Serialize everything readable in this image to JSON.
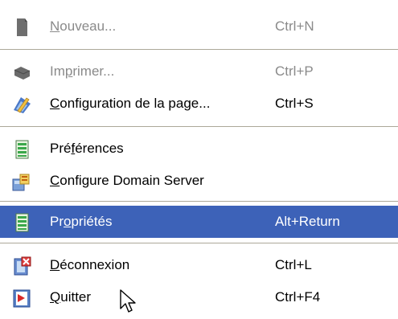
{
  "menu": {
    "items": [
      {
        "label": "Nouveau...",
        "mnemonic": "N",
        "shortcut": "Ctrl+N",
        "icon": "document-icon",
        "state": "disabled"
      },
      {
        "label": "Imprimer...",
        "mnemonic": "p",
        "shortcut": "Ctrl+P",
        "icon": "printer-icon",
        "state": "disabled"
      },
      {
        "label": "Configuration de la page...",
        "mnemonic": "C",
        "shortcut": "Ctrl+S",
        "icon": "page-setup-icon",
        "state": "enabled"
      },
      {
        "label": "Préférences",
        "mnemonic": "f",
        "shortcut": "",
        "icon": "preferences-icon",
        "state": "enabled"
      },
      {
        "label": "Configure Domain Server",
        "mnemonic": "C",
        "shortcut": "",
        "icon": "domain-server-icon",
        "state": "enabled"
      },
      {
        "label": "Propriétés",
        "mnemonic": "o",
        "shortcut": "Alt+Return",
        "icon": "properties-icon",
        "state": "selected"
      },
      {
        "label": "Déconnexion",
        "mnemonic": "D",
        "shortcut": "Ctrl+L",
        "icon": "disconnect-icon",
        "state": "enabled"
      },
      {
        "label": "Quitter",
        "mnemonic": "Q",
        "shortcut": "Ctrl+F4",
        "icon": "exit-icon",
        "state": "enabled"
      }
    ]
  },
  "colors": {
    "selection_bg": "#3d62b8",
    "disabled_text": "#8a8a8a",
    "separator": "#aca899"
  }
}
